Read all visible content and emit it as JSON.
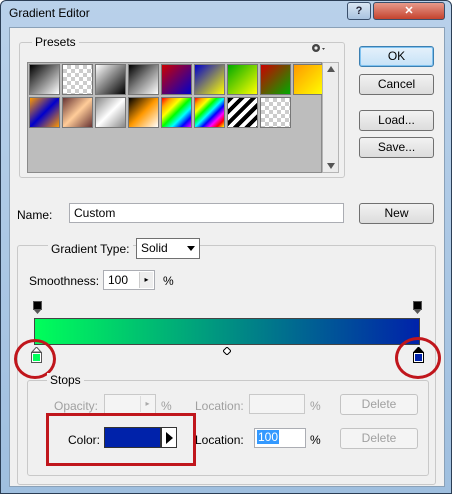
{
  "window": {
    "title": "Gradient Editor",
    "help_label": "?",
    "close_label": "✕"
  },
  "presets": {
    "legend": "Presets",
    "menu_icon": "gear-icon"
  },
  "buttons": {
    "ok": "OK",
    "cancel": "Cancel",
    "load": "Load...",
    "save": "Save...",
    "new": "New"
  },
  "name": {
    "label": "Name:",
    "value": "Custom"
  },
  "gradient": {
    "type_label": "Gradient Type:",
    "type_value": "Solid",
    "smoothness_label": "Smoothness:",
    "smoothness_value": "100",
    "smoothness_unit": "%",
    "start_color": "#00ff5a",
    "end_color": "#0022aa"
  },
  "stops": {
    "legend": "Stops",
    "opacity_label": "Opacity:",
    "opacity_value": "",
    "opacity_unit": "%",
    "opacity_location_label": "Location:",
    "opacity_location_value": "",
    "opacity_location_unit": "%",
    "delete_label": "Delete",
    "color_label": "Color:",
    "color_value": "#0022aa",
    "color_location_label": "Location:",
    "color_location_value": "100",
    "color_location_unit": "%"
  }
}
